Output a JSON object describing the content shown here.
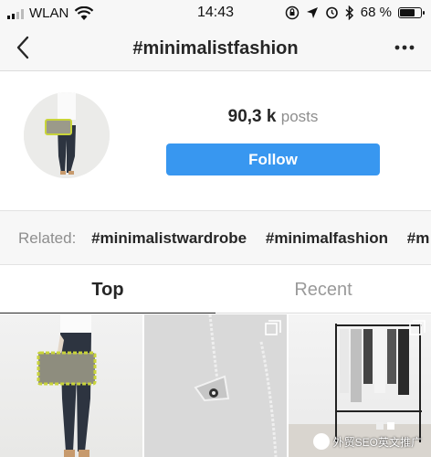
{
  "status_bar": {
    "carrier": "WLAN",
    "time": "14:43",
    "battery": "68 %"
  },
  "nav": {
    "title": "#minimalistfashion"
  },
  "profile": {
    "posts_count": "90,3 k",
    "posts_label": "posts",
    "follow_label": "Follow"
  },
  "related": {
    "label": "Related:",
    "tags": [
      "#minimalistwardrobe",
      "#minimalfashion",
      "#m"
    ]
  },
  "tabs": [
    {
      "label": "Top"
    },
    {
      "label": "Recent"
    }
  ],
  "watermark": {
    "text": "外贸SEO英文推广"
  },
  "colors": {
    "follow_button": "#3897f0",
    "background": "#f7f7f7"
  }
}
